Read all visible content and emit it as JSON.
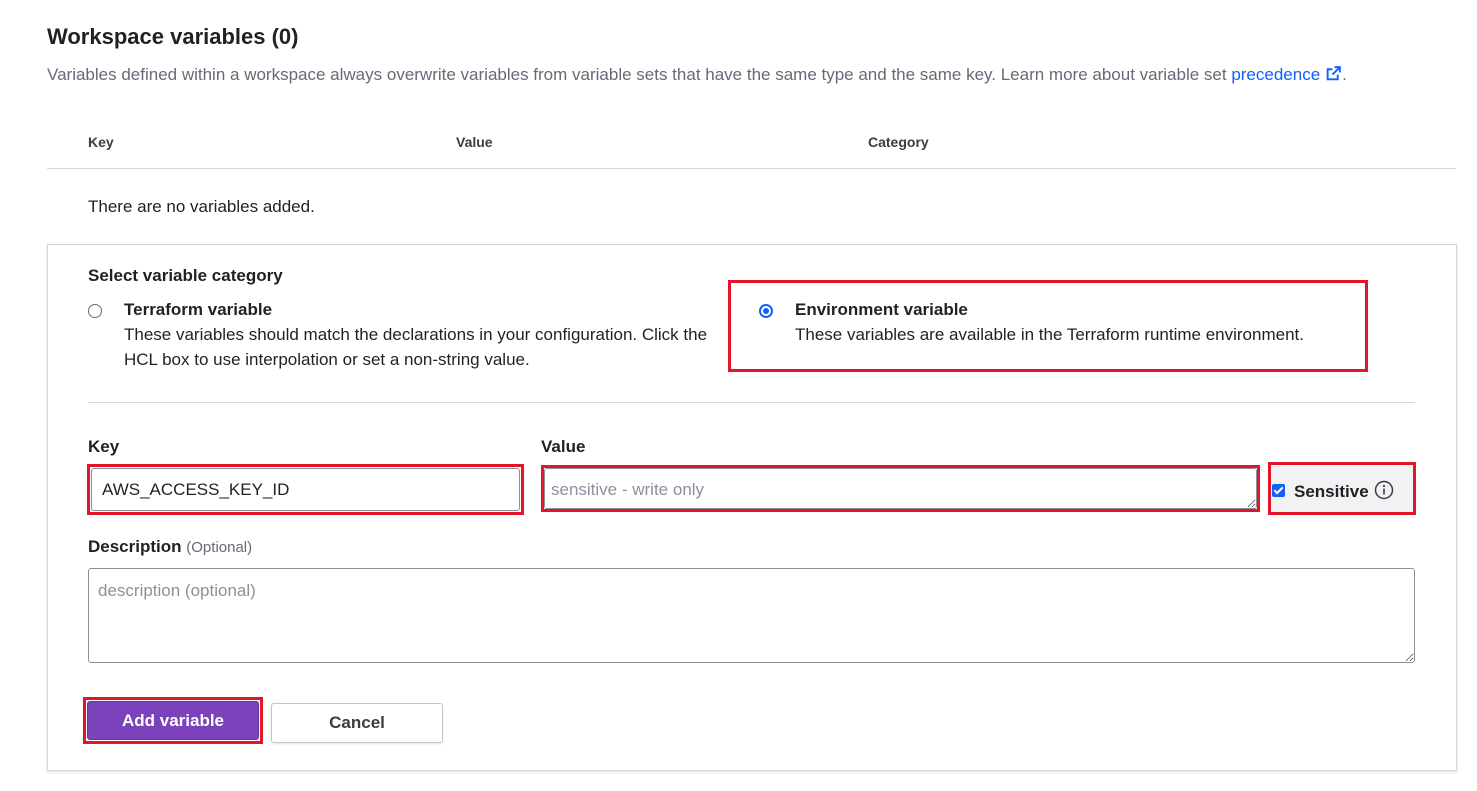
{
  "section": {
    "title": "Workspace variables (0)",
    "description_text": "Variables defined within a workspace always overwrite variables from variable sets that have the same type and the same key. Learn more about variable set ",
    "description_link": "precedence",
    "description_end": "."
  },
  "table": {
    "headers": [
      "Key",
      "Value",
      "Category"
    ],
    "empty_message": "There are no variables added."
  },
  "form": {
    "category_label": "Select variable category",
    "options": [
      {
        "title": "Terraform variable",
        "description": "These variables should match the declarations in your configuration. Click the HCL box to use interpolation or set a non-string value.",
        "selected": false
      },
      {
        "title": "Environment variable",
        "description": "These variables are available in the Terraform runtime environment.",
        "selected": true
      }
    ],
    "key_label": "Key",
    "key_value": "AWS_ACCESS_KEY_ID",
    "value_label": "Value",
    "value_placeholder": "sensitive - write only",
    "sensitive_label": "Sensitive",
    "sensitive_checked": true,
    "description_label": "Description",
    "description_optional": "(Optional)",
    "description_placeholder": "description (optional)",
    "add_button": "Add variable",
    "cancel_button": "Cancel"
  },
  "colors": {
    "accent": "#1060ff",
    "primary_button": "#7b42bc",
    "highlight": "#e3152b"
  }
}
